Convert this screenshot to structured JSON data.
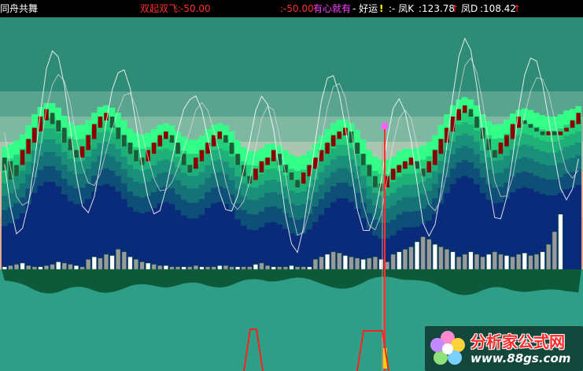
{
  "header": {
    "title": "同舟共舞",
    "shuangqi_label": "双起双飞:",
    "shuangqi_value": "-50.00",
    "value2": ":-50.00",
    "youxin_label": "有心就有",
    "haoyun_label": "- 好运",
    "feng_k_label": ":- 凤K",
    "feng_k_value": ":123.78",
    "feng_d_label": "凤D",
    "feng_d_value": ":108.42",
    "colors": {
      "title": "#ffffff",
      "shuangqi": "#ff3030",
      "youxin": "#ff40ff",
      "haoyun": "#ffff00",
      "feng": "#ffffff",
      "arrow_up": "#ff3030"
    }
  },
  "watermark": {
    "title": "分析家公式网",
    "url": "www.88gs.com"
  },
  "chart_data": {
    "type": "bar",
    "indicators": [
      "双起双飞",
      "有心就有",
      "好运",
      "凤K",
      "凤D"
    ],
    "latest": {
      "双起双飞": -50.0,
      "凤K": 123.78,
      "凤D": 108.42
    },
    "bars_up_color": "#8b0000",
    "bars_down_color": "#1f5a3a",
    "candles": [
      {
        "o": 55,
        "c": 62,
        "t": "d"
      },
      {
        "o": 60,
        "c": 50,
        "t": "d"
      },
      {
        "o": 52,
        "c": 58,
        "t": "d"
      },
      {
        "o": 58,
        "c": 66,
        "t": "u"
      },
      {
        "o": 64,
        "c": 72,
        "t": "u"
      },
      {
        "o": 70,
        "c": 78,
        "t": "u"
      },
      {
        "o": 76,
        "c": 84,
        "t": "u"
      },
      {
        "o": 82,
        "c": 88,
        "t": "u"
      },
      {
        "o": 86,
        "c": 80,
        "t": "d"
      },
      {
        "o": 82,
        "c": 76,
        "t": "d"
      },
      {
        "o": 78,
        "c": 70,
        "t": "d"
      },
      {
        "o": 72,
        "c": 66,
        "t": "d"
      },
      {
        "o": 66,
        "c": 62,
        "t": "d"
      },
      {
        "o": 62,
        "c": 68,
        "t": "u"
      },
      {
        "o": 66,
        "c": 74,
        "t": "u"
      },
      {
        "o": 72,
        "c": 80,
        "t": "u"
      },
      {
        "o": 78,
        "c": 84,
        "t": "u"
      },
      {
        "o": 82,
        "c": 86,
        "t": "u"
      },
      {
        "o": 84,
        "c": 78,
        "t": "d"
      },
      {
        "o": 78,
        "c": 72,
        "t": "d"
      },
      {
        "o": 74,
        "c": 68,
        "t": "d"
      },
      {
        "o": 70,
        "c": 64,
        "t": "d"
      },
      {
        "o": 66,
        "c": 60,
        "t": "d"
      },
      {
        "o": 62,
        "c": 58,
        "t": "d"
      },
      {
        "o": 60,
        "c": 66,
        "t": "u"
      },
      {
        "o": 64,
        "c": 70,
        "t": "u"
      },
      {
        "o": 68,
        "c": 74,
        "t": "u"
      },
      {
        "o": 72,
        "c": 76,
        "t": "u"
      },
      {
        "o": 74,
        "c": 70,
        "t": "d"
      },
      {
        "o": 70,
        "c": 64,
        "t": "d"
      },
      {
        "o": 64,
        "c": 58,
        "t": "d"
      },
      {
        "o": 58,
        "c": 54,
        "t": "d"
      },
      {
        "o": 56,
        "c": 62,
        "t": "u"
      },
      {
        "o": 60,
        "c": 66,
        "t": "u"
      },
      {
        "o": 64,
        "c": 70,
        "t": "u"
      },
      {
        "o": 68,
        "c": 74,
        "t": "u"
      },
      {
        "o": 72,
        "c": 76,
        "t": "u"
      },
      {
        "o": 74,
        "c": 70,
        "t": "d"
      },
      {
        "o": 70,
        "c": 64,
        "t": "d"
      },
      {
        "o": 64,
        "c": 58,
        "t": "d"
      },
      {
        "o": 58,
        "c": 52,
        "t": "d"
      },
      {
        "o": 52,
        "c": 48,
        "t": "d"
      },
      {
        "o": 50,
        "c": 56,
        "t": "u"
      },
      {
        "o": 54,
        "c": 60,
        "t": "u"
      },
      {
        "o": 58,
        "c": 62,
        "t": "u"
      },
      {
        "o": 60,
        "c": 66,
        "t": "u"
      },
      {
        "o": 64,
        "c": 58,
        "t": "d"
      },
      {
        "o": 58,
        "c": 54,
        "t": "d"
      },
      {
        "o": 54,
        "c": 50,
        "t": "d"
      },
      {
        "o": 50,
        "c": 46,
        "t": "d"
      },
      {
        "o": 48,
        "c": 54,
        "t": "u"
      },
      {
        "o": 52,
        "c": 58,
        "t": "u"
      },
      {
        "o": 56,
        "c": 62,
        "t": "u"
      },
      {
        "o": 60,
        "c": 66,
        "t": "u"
      },
      {
        "o": 64,
        "c": 70,
        "t": "u"
      },
      {
        "o": 68,
        "c": 74,
        "t": "u"
      },
      {
        "o": 72,
        "c": 76,
        "t": "u"
      },
      {
        "o": 74,
        "c": 78,
        "t": "u"
      },
      {
        "o": 76,
        "c": 70,
        "t": "d"
      },
      {
        "o": 70,
        "c": 64,
        "t": "d"
      },
      {
        "o": 64,
        "c": 58,
        "t": "d"
      },
      {
        "o": 58,
        "c": 52,
        "t": "d"
      },
      {
        "o": 52,
        "c": 46,
        "t": "d"
      },
      {
        "o": 48,
        "c": 44,
        "t": "d"
      },
      {
        "o": 46,
        "c": 52,
        "t": "u"
      },
      {
        "o": 50,
        "c": 56,
        "t": "u"
      },
      {
        "o": 54,
        "c": 58,
        "t": "u"
      },
      {
        "o": 56,
        "c": 60,
        "t": "u"
      },
      {
        "o": 58,
        "c": 62,
        "t": "u"
      },
      {
        "o": 60,
        "c": 56,
        "t": "d"
      },
      {
        "o": 56,
        "c": 52,
        "t": "d"
      },
      {
        "o": 54,
        "c": 60,
        "t": "u"
      },
      {
        "o": 58,
        "c": 66,
        "t": "u"
      },
      {
        "o": 64,
        "c": 72,
        "t": "u"
      },
      {
        "o": 70,
        "c": 78,
        "t": "u"
      },
      {
        "o": 76,
        "c": 84,
        "t": "u"
      },
      {
        "o": 82,
        "c": 88,
        "t": "u"
      },
      {
        "o": 86,
        "c": 90,
        "t": "u"
      },
      {
        "o": 88,
        "c": 84,
        "t": "d"
      },
      {
        "o": 84,
        "c": 78,
        "t": "d"
      },
      {
        "o": 78,
        "c": 72,
        "t": "d"
      },
      {
        "o": 72,
        "c": 66,
        "t": "d"
      },
      {
        "o": 66,
        "c": 62,
        "t": "d"
      },
      {
        "o": 64,
        "c": 70,
        "t": "u"
      },
      {
        "o": 68,
        "c": 74,
        "t": "u"
      },
      {
        "o": 72,
        "c": 80,
        "t": "u"
      },
      {
        "o": 78,
        "c": 84,
        "t": "u"
      },
      {
        "o": 82,
        "c": 80,
        "t": "d"
      },
      {
        "o": 80,
        "c": 78,
        "t": "d"
      },
      {
        "o": 78,
        "c": 76,
        "t": "d"
      },
      {
        "o": 76,
        "c": 74,
        "t": "d"
      },
      {
        "o": 74,
        "c": 76,
        "t": "u"
      },
      {
        "o": 76,
        "c": 74,
        "t": "d"
      },
      {
        "o": 74,
        "c": 76,
        "t": "u"
      },
      {
        "o": 76,
        "c": 78,
        "t": "u"
      },
      {
        "o": 78,
        "c": 82,
        "t": "u"
      },
      {
        "o": 80,
        "c": 86,
        "t": "u"
      }
    ],
    "volume": [
      2,
      3,
      4,
      5,
      3,
      2,
      2,
      3,
      4,
      6,
      5,
      4,
      3,
      2,
      8,
      10,
      9,
      12,
      11,
      16,
      14,
      10,
      8,
      6,
      5,
      4,
      3,
      3,
      2,
      2,
      2,
      2,
      3,
      2,
      2,
      2,
      3,
      3,
      2,
      2,
      2,
      2,
      4,
      5,
      3,
      2,
      2,
      2,
      3,
      2,
      2,
      2,
      8,
      10,
      12,
      14,
      13,
      11,
      10,
      9,
      8,
      9,
      10,
      8,
      6,
      12,
      14,
      16,
      18,
      22,
      26,
      24,
      20,
      18,
      16,
      14,
      10,
      12,
      14,
      12,
      10,
      12,
      14,
      12,
      11,
      10,
      12,
      13,
      11,
      12,
      14,
      20,
      30,
      44
    ]
  }
}
